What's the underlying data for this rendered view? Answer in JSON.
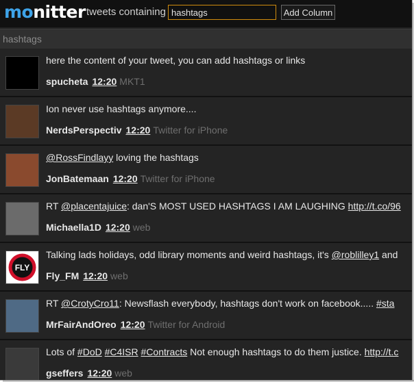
{
  "header": {
    "logo_part1": "mo",
    "logo_part2": "nitter",
    "tagline": "tweets containing",
    "search_value": "hashtags",
    "add_button": "Add Column"
  },
  "column": {
    "title": "hashtags"
  },
  "tweets": [
    {
      "parts": [
        {
          "t": "here the content of your tweet, you can add hashtags or links"
        }
      ],
      "user": "spucheta",
      "time": "12:20",
      "source": "MKT1",
      "avatar": "#000000"
    },
    {
      "parts": [
        {
          "t": "Ion never use hashtags anymore...."
        }
      ],
      "user": "NerdsPerspectiv",
      "time": "12:20",
      "source": "Twitter for iPhone",
      "avatar": "#5b3a25"
    },
    {
      "parts": [
        {
          "t": "@RossFindlayy",
          "link": true
        },
        {
          "t": " loving the hashtags"
        }
      ],
      "user": "JonBatemaan",
      "time": "12:20",
      "source": "Twitter for iPhone",
      "avatar": "#8a4a2e"
    },
    {
      "parts": [
        {
          "t": "RT "
        },
        {
          "t": "@placentajuice",
          "link": true
        },
        {
          "t": ": dan'S MOST USED HASHTAGS I AM LAUGHING "
        },
        {
          "t": "http://t.co/96",
          "link": true
        }
      ],
      "user": "Michaella1D",
      "time": "12:20",
      "source": "web",
      "avatar": "#6b6b6b"
    },
    {
      "parts": [
        {
          "t": "Talking lads holidays, odd library moments and weird hashtags, it's "
        },
        {
          "t": "@roblilley1",
          "link": true
        },
        {
          "t": " and"
        }
      ],
      "user": "Fly_FM",
      "time": "12:20",
      "source": "web",
      "avatar": "#ffffff"
    },
    {
      "parts": [
        {
          "t": "RT "
        },
        {
          "t": "@CrotyCro11",
          "link": true
        },
        {
          "t": ": Newsflash everybody, hashtags don't work on facebook..... "
        },
        {
          "t": "#sta",
          "link": true
        }
      ],
      "user": "MrFairAndOreo",
      "time": "12:20",
      "source": "Twitter for Android",
      "avatar": "#4f6a85"
    },
    {
      "parts": [
        {
          "t": "Lots of "
        },
        {
          "t": "#DoD",
          "link": true
        },
        {
          "t": " "
        },
        {
          "t": "#C4ISR",
          "link": true
        },
        {
          "t": " "
        },
        {
          "t": "#Contracts",
          "link": true
        },
        {
          "t": " Not enough hashtags to do them justice. "
        },
        {
          "t": "http://t.c",
          "link": true
        }
      ],
      "user": "gseffers",
      "time": "12:20",
      "source": "web",
      "avatar": "#3a3a3a"
    }
  ],
  "colors": {
    "accent": "#3ea3e8",
    "search_border": "#d08c0e",
    "background": "#222222"
  }
}
